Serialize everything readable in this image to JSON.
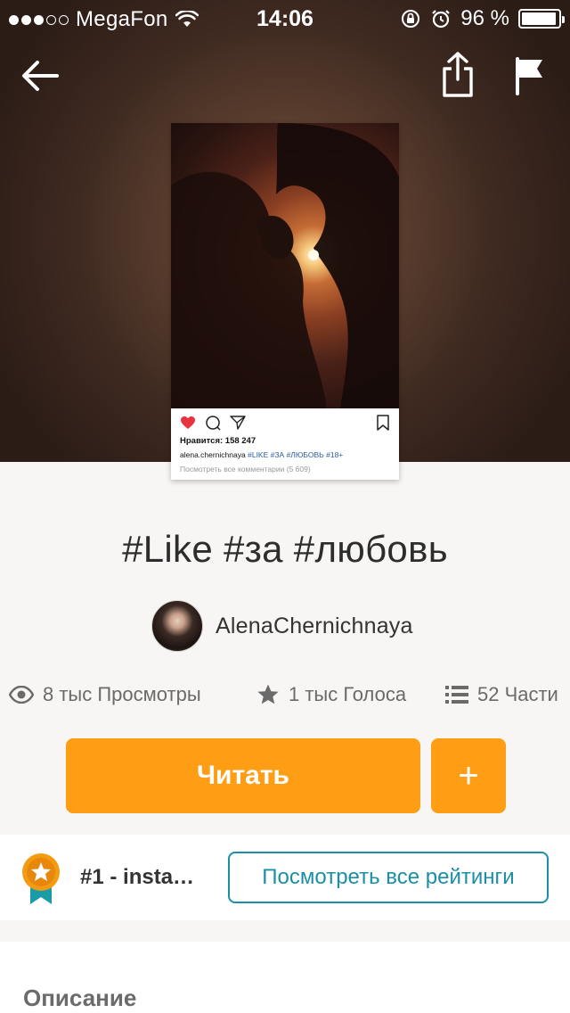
{
  "status_bar": {
    "carrier": "MegaFon",
    "time": "14:06",
    "battery": "96 %",
    "battery_level": 0.96
  },
  "nav": {
    "back_icon": "arrow-left-icon",
    "share_icon": "share-icon",
    "flag_icon": "flag-icon"
  },
  "cover": {
    "likes": "Нравится: 158 247",
    "caption_user": "alena.chernichnaya",
    "caption_tags": "#LIKE #ЗА #ЛЮБОВЬ #18+",
    "comments": "Посмотреть все комментарии (5 609)"
  },
  "story": {
    "title": "#Like #за #любовь",
    "author": "AlenaChernichnaya"
  },
  "stats": {
    "views": "8 тыс Просмотры",
    "votes": "1 тыс Голоса",
    "parts": "52 Части"
  },
  "actions": {
    "read_label": "Читать",
    "add_label": "+"
  },
  "ranking": {
    "rank_text": "#1 - insta…",
    "view_all_label": "Посмотреть все рейтинги"
  },
  "description": {
    "heading": "Описание"
  },
  "colors": {
    "accent": "#ff9d14",
    "link": "#1a8fa6",
    "background": "#f8f6f4"
  }
}
